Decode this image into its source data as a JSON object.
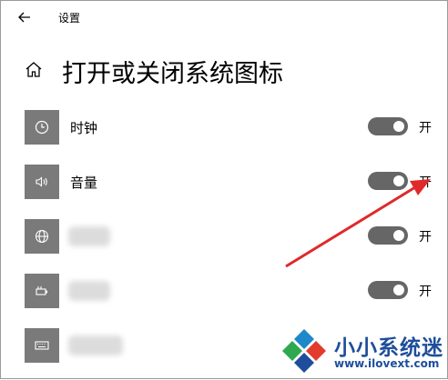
{
  "window": {
    "title": "设置"
  },
  "page": {
    "title": "打开或关闭系统图标"
  },
  "items": [
    {
      "label": "时钟",
      "icon": "clock-icon",
      "state": "开",
      "on": true
    },
    {
      "label": "音量",
      "icon": "volume-icon",
      "state": "开",
      "on": true
    },
    {
      "label": "",
      "icon": "globe-icon",
      "state": "开",
      "on": true
    },
    {
      "label": "",
      "icon": "power-icon",
      "state": "开",
      "on": true
    },
    {
      "label": "",
      "icon": "keyboard-icon",
      "state": "",
      "on": null
    }
  ],
  "watermark": {
    "text": "小小系统迷",
    "url": "www.ilovext.com"
  },
  "colors": {
    "icon_bg": "#7a7a7a",
    "toggle_on": "#666666",
    "arrow": "#e0292a",
    "watermark": "#1e4e9b"
  }
}
